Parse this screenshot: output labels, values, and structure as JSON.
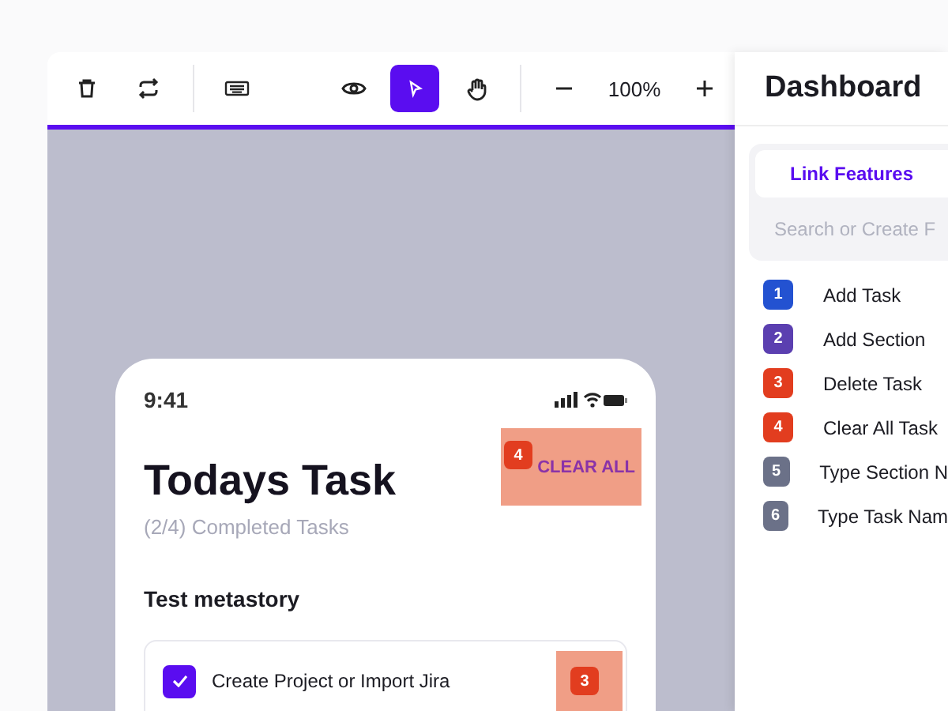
{
  "toolbar": {
    "tools": [
      {
        "kind": "trash",
        "selected": false
      },
      {
        "kind": "swap",
        "selected": false
      },
      {
        "kind": "sep"
      },
      {
        "kind": "keyboard",
        "selected": false
      },
      {
        "kind": "gap"
      },
      {
        "kind": "eye",
        "selected": false
      },
      {
        "kind": "pointer",
        "selected": true
      },
      {
        "kind": "hand",
        "selected": false
      },
      {
        "kind": "sep"
      },
      {
        "kind": "minus",
        "selected": false
      }
    ],
    "zoom": "100%"
  },
  "phone": {
    "time": "9:41",
    "title": "Todays Task",
    "subtitle": "(2/4) Completed Tasks",
    "clear_all": {
      "label": "CLEAR ALL",
      "badge": "4"
    },
    "section": "Test metastory",
    "tasks": [
      {
        "label": "Create Project or Import Jira",
        "checked": true,
        "badge": "3"
      }
    ]
  },
  "sidebar": {
    "title": "Dashboard",
    "tabs": [
      {
        "label": "Link Features",
        "selected": true
      }
    ],
    "search": {
      "placeholder": "Search or Create F"
    },
    "features": [
      {
        "number": "1",
        "label": "Add Task",
        "color": "#2352d1"
      },
      {
        "number": "2",
        "label": "Add Section",
        "color": "#5b3fb0"
      },
      {
        "number": "3",
        "label": "Delete Task",
        "color": "#e23d1f"
      },
      {
        "number": "4",
        "label": "Clear All Task",
        "color": "#e23d1f"
      },
      {
        "number": "5",
        "label": "Type Section N",
        "color": "#6b7188"
      },
      {
        "number": "6",
        "label": "Type Task Nam",
        "color": "#6b7188"
      }
    ]
  }
}
